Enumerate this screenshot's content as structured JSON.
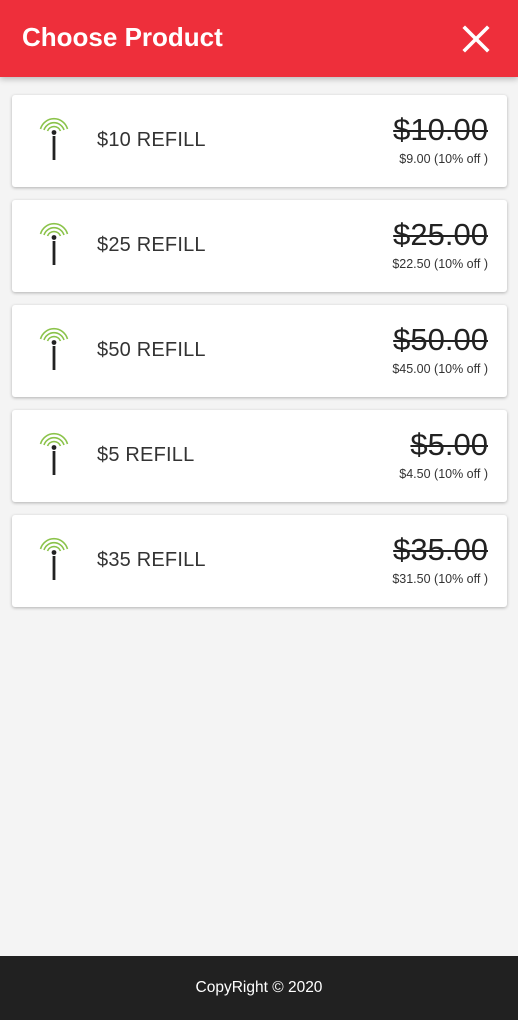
{
  "header": {
    "title": "Choose Product",
    "close_icon": "close-icon",
    "background": "#ee2f3b"
  },
  "products": [
    {
      "name": "$10 REFILL",
      "price": "$10.00",
      "discount_price": "$9.00",
      "discount_note": "(10% off )",
      "icon": "signal-tower-icon"
    },
    {
      "name": "$25 REFILL",
      "price": "$25.00",
      "discount_price": "$22.50",
      "discount_note": "(10% off )",
      "icon": "signal-tower-icon"
    },
    {
      "name": "$50 REFILL",
      "price": "$50.00",
      "discount_price": "$45.00",
      "discount_note": "(10% off )",
      "icon": "signal-tower-icon"
    },
    {
      "name": "$5 REFILL",
      "price": "$5.00",
      "discount_price": "$4.50",
      "discount_note": "(10% off )",
      "icon": "signal-tower-icon"
    },
    {
      "name": "$35 REFILL",
      "price": "$35.00",
      "discount_price": "$31.50",
      "discount_note": "(10% off )",
      "icon": "signal-tower-icon"
    }
  ],
  "footer": {
    "text": "CopyRight © 2020",
    "background": "#212121"
  },
  "colors": {
    "signal_waves": "#8bc34a",
    "tower": "#222222"
  }
}
